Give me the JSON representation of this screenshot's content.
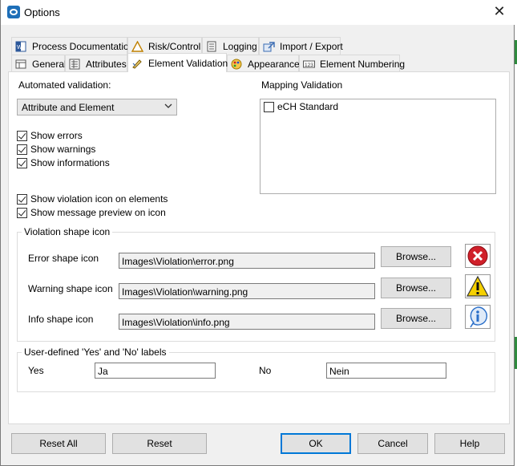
{
  "window": {
    "title": "Options"
  },
  "tabs_row1": [
    {
      "label": "Process Documentation",
      "icon": "word-doc-icon"
    },
    {
      "label": "Risk/Control",
      "icon": "warning-triangle-icon"
    },
    {
      "label": "Logging",
      "icon": "log-document-icon"
    },
    {
      "label": "Import / Export",
      "icon": "import-export-icon"
    }
  ],
  "tabs_row2": [
    {
      "label": "General",
      "icon": "general-grid-icon"
    },
    {
      "label": "Attributes",
      "icon": "attributes-icon"
    },
    {
      "label": "Element Validation",
      "icon": "validation-pen-icon",
      "active": true
    },
    {
      "label": "Appearance",
      "icon": "palette-icon"
    },
    {
      "label": "Element Numbering",
      "icon": "numbering-icon"
    }
  ],
  "validation": {
    "automated_label": "Automated validation:",
    "automated_value": "Attribute and Element",
    "checkboxes": [
      {
        "label": "Show errors",
        "checked": true
      },
      {
        "label": "Show warnings",
        "checked": true
      },
      {
        "label": "Show informations",
        "checked": true
      },
      {
        "label": "Show violation icon on elements",
        "checked": true
      },
      {
        "label": "Show message preview on icon",
        "checked": true
      }
    ]
  },
  "mapping": {
    "label": "Mapping Validation",
    "items": [
      {
        "label": "eCH Standard",
        "checked": false
      }
    ]
  },
  "violation_group": {
    "title": "Violation shape icon",
    "rows": [
      {
        "label": "Error shape icon",
        "path": "Images\\Violation\\error.png",
        "browse": "Browse...",
        "icon": "error-icon"
      },
      {
        "label": "Warning shape icon",
        "path": "Images\\Violation\\warning.png",
        "browse": "Browse...",
        "icon": "warning-icon"
      },
      {
        "label": "Info shape icon",
        "path": "Images\\Violation\\info.png",
        "browse": "Browse...",
        "icon": "info-icon"
      }
    ]
  },
  "labels_group": {
    "title": "User-defined 'Yes' and 'No' labels",
    "yes_label": "Yes",
    "yes_value": "Ja",
    "no_label": "No",
    "no_value": "Nein"
  },
  "buttons": {
    "reset_all": "Reset All",
    "reset": "Reset",
    "ok": "OK",
    "cancel": "Cancel",
    "help": "Help"
  },
  "colors": {
    "dialog_bg": "#f0f0f0",
    "panel_bg": "#ffffff",
    "default_button_border": "#0078d7",
    "error_red": "#d0202a",
    "warning_yellow": "#f5d000",
    "info_blue": "#2a6fc9"
  }
}
